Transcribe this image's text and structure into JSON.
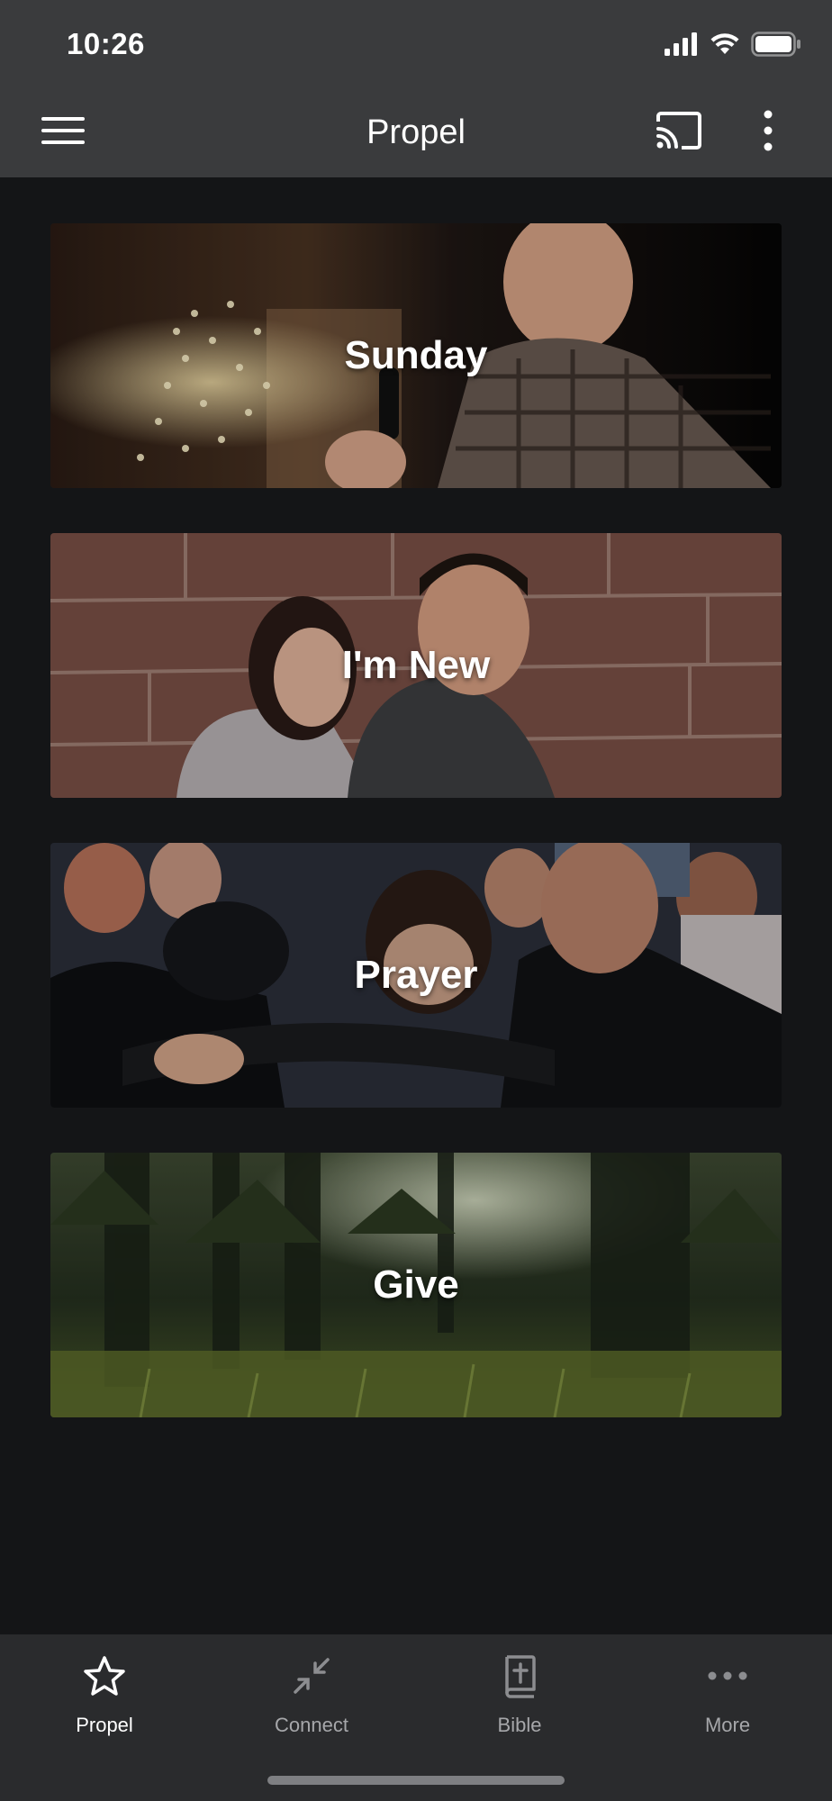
{
  "status_bar": {
    "time": "10:26"
  },
  "app_bar": {
    "title": "Propel",
    "icons": {
      "menu": "menu-icon",
      "cast": "cast-icon",
      "more": "more-vertical-icon"
    }
  },
  "cards": [
    {
      "label": "Sunday",
      "image": "speaker with microphone"
    },
    {
      "label": "I'm New",
      "image": "smiling couple"
    },
    {
      "label": "Prayer",
      "image": "men praying together"
    },
    {
      "label": "Give",
      "image": "forest"
    }
  ],
  "bottom_nav": {
    "items": [
      {
        "label": "Propel",
        "icon": "star-icon",
        "active": true
      },
      {
        "label": "Connect",
        "icon": "collapse-arrows-icon",
        "active": false
      },
      {
        "label": "Bible",
        "icon": "bible-icon",
        "active": false
      },
      {
        "label": "More",
        "icon": "more-horizontal-icon",
        "active": false
      }
    ]
  },
  "colors": {
    "bar_background": "#3a3b3d",
    "page_background": "#141517",
    "nav_background": "#2a2b2d",
    "active_text": "#ffffff",
    "inactive_text": "#a6a7aa"
  }
}
